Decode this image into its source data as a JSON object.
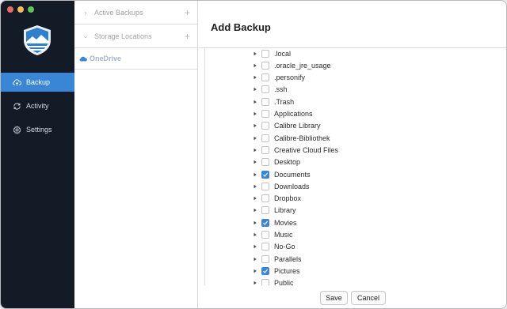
{
  "window": {
    "traffic_lights": [
      "#ed6a5e",
      "#f5bf4f",
      "#61c554"
    ]
  },
  "sidebar": {
    "items": [
      {
        "label": "Backup",
        "icon": "cloud-upload-icon",
        "active": true
      },
      {
        "label": "Activity",
        "icon": "refresh-icon",
        "active": false
      },
      {
        "label": "Settings",
        "icon": "gear-icon",
        "active": false
      }
    ]
  },
  "middle": {
    "sections": [
      {
        "label": "Active Backups",
        "expanded": false
      },
      {
        "label": "Storage Locations",
        "expanded": true
      }
    ],
    "storage": [
      {
        "label": "OneDrive",
        "icon": "cloud-icon"
      }
    ]
  },
  "main": {
    "title": "Add Backup",
    "folders": [
      {
        "name": ".local",
        "checked": false
      },
      {
        "name": ".oracle_jre_usage",
        "checked": false
      },
      {
        "name": ".personify",
        "checked": false
      },
      {
        "name": ".ssh",
        "checked": false
      },
      {
        "name": ".Trash",
        "checked": false
      },
      {
        "name": "Applications",
        "checked": false
      },
      {
        "name": "Calibre Library",
        "checked": false
      },
      {
        "name": "Calibre-Bibliothek",
        "checked": false
      },
      {
        "name": "Creative Cloud Files",
        "checked": false
      },
      {
        "name": "Desktop",
        "checked": false
      },
      {
        "name": "Documents",
        "checked": true
      },
      {
        "name": "Downloads",
        "checked": false
      },
      {
        "name": "Dropbox",
        "checked": false
      },
      {
        "name": "Library",
        "checked": false
      },
      {
        "name": "Movies",
        "checked": true
      },
      {
        "name": "Music",
        "checked": false
      },
      {
        "name": "No-Go",
        "checked": false
      },
      {
        "name": "Parallels",
        "checked": false
      },
      {
        "name": "Pictures",
        "checked": true
      },
      {
        "name": "Public",
        "checked": false
      }
    ],
    "save_label": "Save",
    "cancel_label": "Cancel"
  },
  "colors": {
    "sidebar_bg": "#121b26",
    "accent": "#3a86d6"
  }
}
